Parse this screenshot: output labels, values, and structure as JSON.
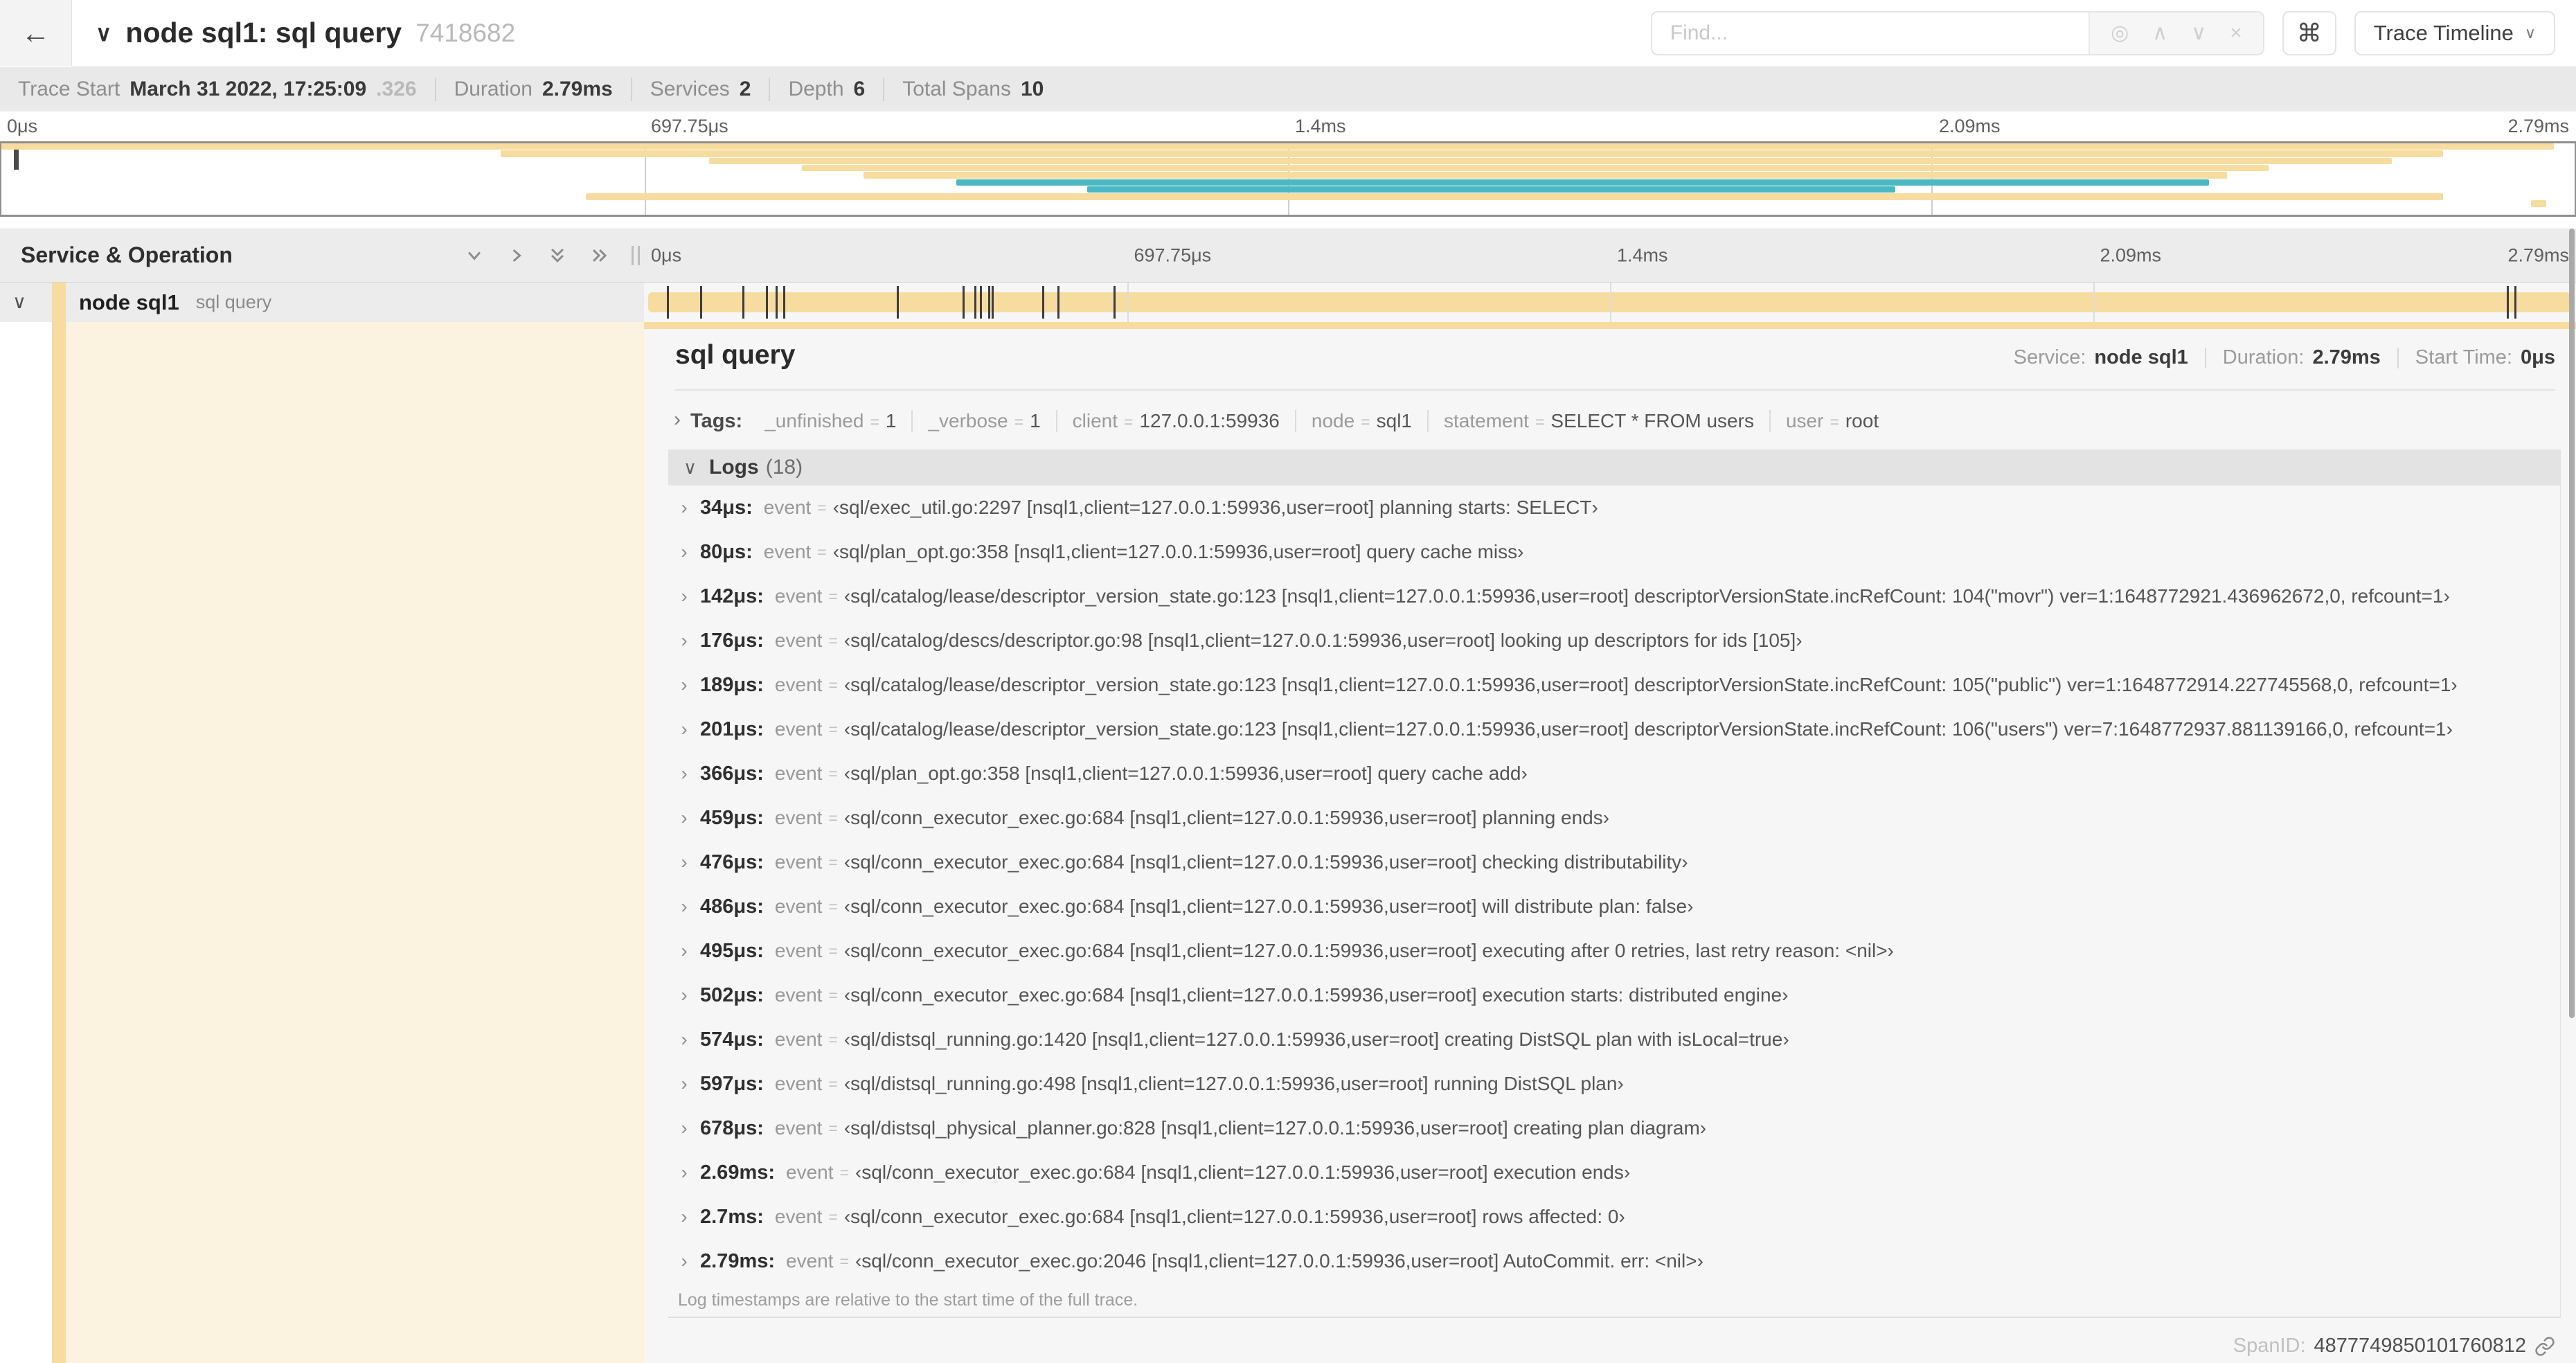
{
  "colors": {
    "tan": "#F7DCA0",
    "teal": "#4AB9C4",
    "cream": "#FBF3E0"
  },
  "topbar": {
    "back_icon": "←",
    "collapse_icon": "∨",
    "title": "node sql1: sql query",
    "trace_id_short": "7418682",
    "find_placeholder": "Find...",
    "suffix_icons": {
      "target": "◎",
      "prev": "∧",
      "next": "∨",
      "clear": "×"
    },
    "kbd_icon": "⌘",
    "view_select_label": "Trace Timeline",
    "view_select_chevron": "∨"
  },
  "summary": {
    "trace_start_label": "Trace Start",
    "trace_start_value": "March 31 2022, 17:25:09",
    "trace_start_frac": ".326",
    "duration_label": "Duration",
    "duration_value": "2.79ms",
    "services_label": "Services",
    "services_value": "2",
    "depth_label": "Depth",
    "depth_value": "6",
    "total_spans_label": "Total Spans",
    "total_spans_value": "10"
  },
  "minimap": {
    "tick_labels": [
      "0μs",
      "697.75μs",
      "1.4ms",
      "2.09ms",
      "2.79ms"
    ],
    "tick_pcts": [
      0,
      25,
      50,
      75,
      100
    ],
    "grid_pcts": [
      25,
      50,
      75
    ],
    "spans": [
      {
        "row": 0,
        "start_pct": 0,
        "end_pct": 99.2,
        "color": "tan"
      },
      {
        "row": 1,
        "start_pct": 19.4,
        "end_pct": 94.9,
        "color": "tan"
      },
      {
        "row": 2,
        "start_pct": 27.5,
        "end_pct": 92.9,
        "color": "tan"
      },
      {
        "row": 3,
        "start_pct": 31.1,
        "end_pct": 88.1,
        "color": "tan"
      },
      {
        "row": 4,
        "start_pct": 33.5,
        "end_pct": 86.5,
        "color": "tan"
      },
      {
        "row": 5,
        "start_pct": 37.1,
        "end_pct": 85.8,
        "color": "teal"
      },
      {
        "row": 6,
        "start_pct": 42.2,
        "end_pct": 73.6,
        "color": "teal"
      },
      {
        "row": 7,
        "start_pct": 22.7,
        "end_pct": 94.9,
        "color": "tan"
      },
      {
        "row": 8,
        "start_pct": 98.3,
        "end_pct": 98.9,
        "color": "tan"
      }
    ],
    "total_rows": 10
  },
  "timeline": {
    "left_header": "Service & Operation",
    "tick_labels": [
      "0μs",
      "697.75μs",
      "1.4ms",
      "2.09ms",
      "2.79ms"
    ],
    "tick_pcts": [
      0,
      25,
      50,
      75,
      100
    ],
    "grid_pcts": [
      25,
      50,
      75
    ]
  },
  "span_row": {
    "collapse_icon": "∨",
    "service": "node sql1",
    "operation": "sql query",
    "marker_pcts": [
      1.2,
      2.9,
      5.1,
      6.3,
      6.8,
      7.2,
      13.1,
      16.5,
      17.1,
      17.4,
      17.8,
      18.0,
      20.6,
      21.4,
      24.3,
      96.4,
      96.8,
      99.8
    ]
  },
  "detail": {
    "title": "sql query",
    "service_label": "Service:",
    "service_value": "node sql1",
    "duration_label": "Duration:",
    "duration_value": "2.79ms",
    "start_label": "Start Time:",
    "start_value": "0μs",
    "tags_chevron": "›",
    "tags_label": "Tags:",
    "tags": [
      {
        "key": "_unfinished",
        "value": "1"
      },
      {
        "key": "_verbose",
        "value": "1"
      },
      {
        "key": "client",
        "value": "127.0.0.1:59936"
      },
      {
        "key": "node",
        "value": "sql1"
      },
      {
        "key": "statement",
        "value": "SELECT * FROM users"
      },
      {
        "key": "user",
        "value": "root"
      }
    ],
    "logs_chevron": "∨",
    "logs_label": "Logs",
    "logs_count": "(18)",
    "log_event_key": "event",
    "log_eq": "=",
    "logs": [
      {
        "time": "34μs:",
        "value": "‹sql/exec_util.go:2297 [nsql1,client=127.0.0.1:59936,user=root] planning starts: SELECT›"
      },
      {
        "time": "80μs:",
        "value": "‹sql/plan_opt.go:358 [nsql1,client=127.0.0.1:59936,user=root] query cache miss›"
      },
      {
        "time": "142μs:",
        "value": "‹sql/catalog/lease/descriptor_version_state.go:123 [nsql1,client=127.0.0.1:59936,user=root] descriptorVersionState.incRefCount: 104(\"movr\") ver=1:1648772921.436962672,0, refcount=1›"
      },
      {
        "time": "176μs:",
        "value": "‹sql/catalog/descs/descriptor.go:98 [nsql1,client=127.0.0.1:59936,user=root] looking up descriptors for ids [105]›"
      },
      {
        "time": "189μs:",
        "value": "‹sql/catalog/lease/descriptor_version_state.go:123 [nsql1,client=127.0.0.1:59936,user=root] descriptorVersionState.incRefCount: 105(\"public\") ver=1:1648772914.227745568,0, refcount=1›"
      },
      {
        "time": "201μs:",
        "value": "‹sql/catalog/lease/descriptor_version_state.go:123 [nsql1,client=127.0.0.1:59936,user=root] descriptorVersionState.incRefCount: 106(\"users\") ver=7:1648772937.881139166,0, refcount=1›"
      },
      {
        "time": "366μs:",
        "value": "‹sql/plan_opt.go:358 [nsql1,client=127.0.0.1:59936,user=root] query cache add›"
      },
      {
        "time": "459μs:",
        "value": "‹sql/conn_executor_exec.go:684 [nsql1,client=127.0.0.1:59936,user=root] planning ends›"
      },
      {
        "time": "476μs:",
        "value": "‹sql/conn_executor_exec.go:684 [nsql1,client=127.0.0.1:59936,user=root] checking distributability›"
      },
      {
        "time": "486μs:",
        "value": "‹sql/conn_executor_exec.go:684 [nsql1,client=127.0.0.1:59936,user=root] will distribute plan: false›"
      },
      {
        "time": "495μs:",
        "value": "‹sql/conn_executor_exec.go:684 [nsql1,client=127.0.0.1:59936,user=root] executing after 0 retries, last retry reason: <nil>›"
      },
      {
        "time": "502μs:",
        "value": "‹sql/conn_executor_exec.go:684 [nsql1,client=127.0.0.1:59936,user=root] execution starts: distributed engine›"
      },
      {
        "time": "574μs:",
        "value": "‹sql/distsql_running.go:1420 [nsql1,client=127.0.0.1:59936,user=root] creating DistSQL plan with isLocal=true›"
      },
      {
        "time": "597μs:",
        "value": "‹sql/distsql_running.go:498 [nsql1,client=127.0.0.1:59936,user=root] running DistSQL plan›"
      },
      {
        "time": "678μs:",
        "value": "‹sql/distsql_physical_planner.go:828 [nsql1,client=127.0.0.1:59936,user=root] creating plan diagram›"
      },
      {
        "time": "2.69ms:",
        "value": "‹sql/conn_executor_exec.go:684 [nsql1,client=127.0.0.1:59936,user=root] execution ends›"
      },
      {
        "time": "2.7ms:",
        "value": "‹sql/conn_executor_exec.go:684 [nsql1,client=127.0.0.1:59936,user=root] rows affected: 0›"
      },
      {
        "time": "2.79ms:",
        "value": "‹sql/conn_executor_exec.go:2046 [nsql1,client=127.0.0.1:59936,user=root] AutoCommit. err: <nil>›"
      }
    ],
    "logs_note": "Log timestamps are relative to the start time of the full trace.",
    "spanid_label": "SpanID:",
    "spanid_value": "4877749850101760812"
  }
}
